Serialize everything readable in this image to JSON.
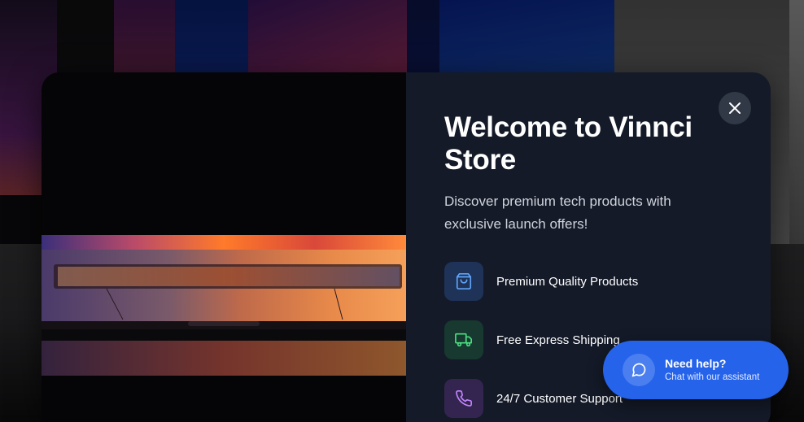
{
  "modal": {
    "title": "Welcome to Vinnci Store",
    "subtitle": "Discover premium tech products with exclusive launch offers!",
    "features": [
      {
        "icon": "shopping-bag-icon",
        "label": "Premium Quality Products",
        "color": "#60a5fa"
      },
      {
        "icon": "truck-icon",
        "label": "Free Express Shipping",
        "color": "#4ade80"
      },
      {
        "icon": "phone-icon",
        "label": "24/7 Customer Support",
        "color": "#c084fc"
      }
    ]
  },
  "help": {
    "title": "Need help?",
    "subtitle": "Chat with our assistant"
  },
  "colors": {
    "accent": "#2563eb",
    "modal_bg": "#141a28"
  }
}
